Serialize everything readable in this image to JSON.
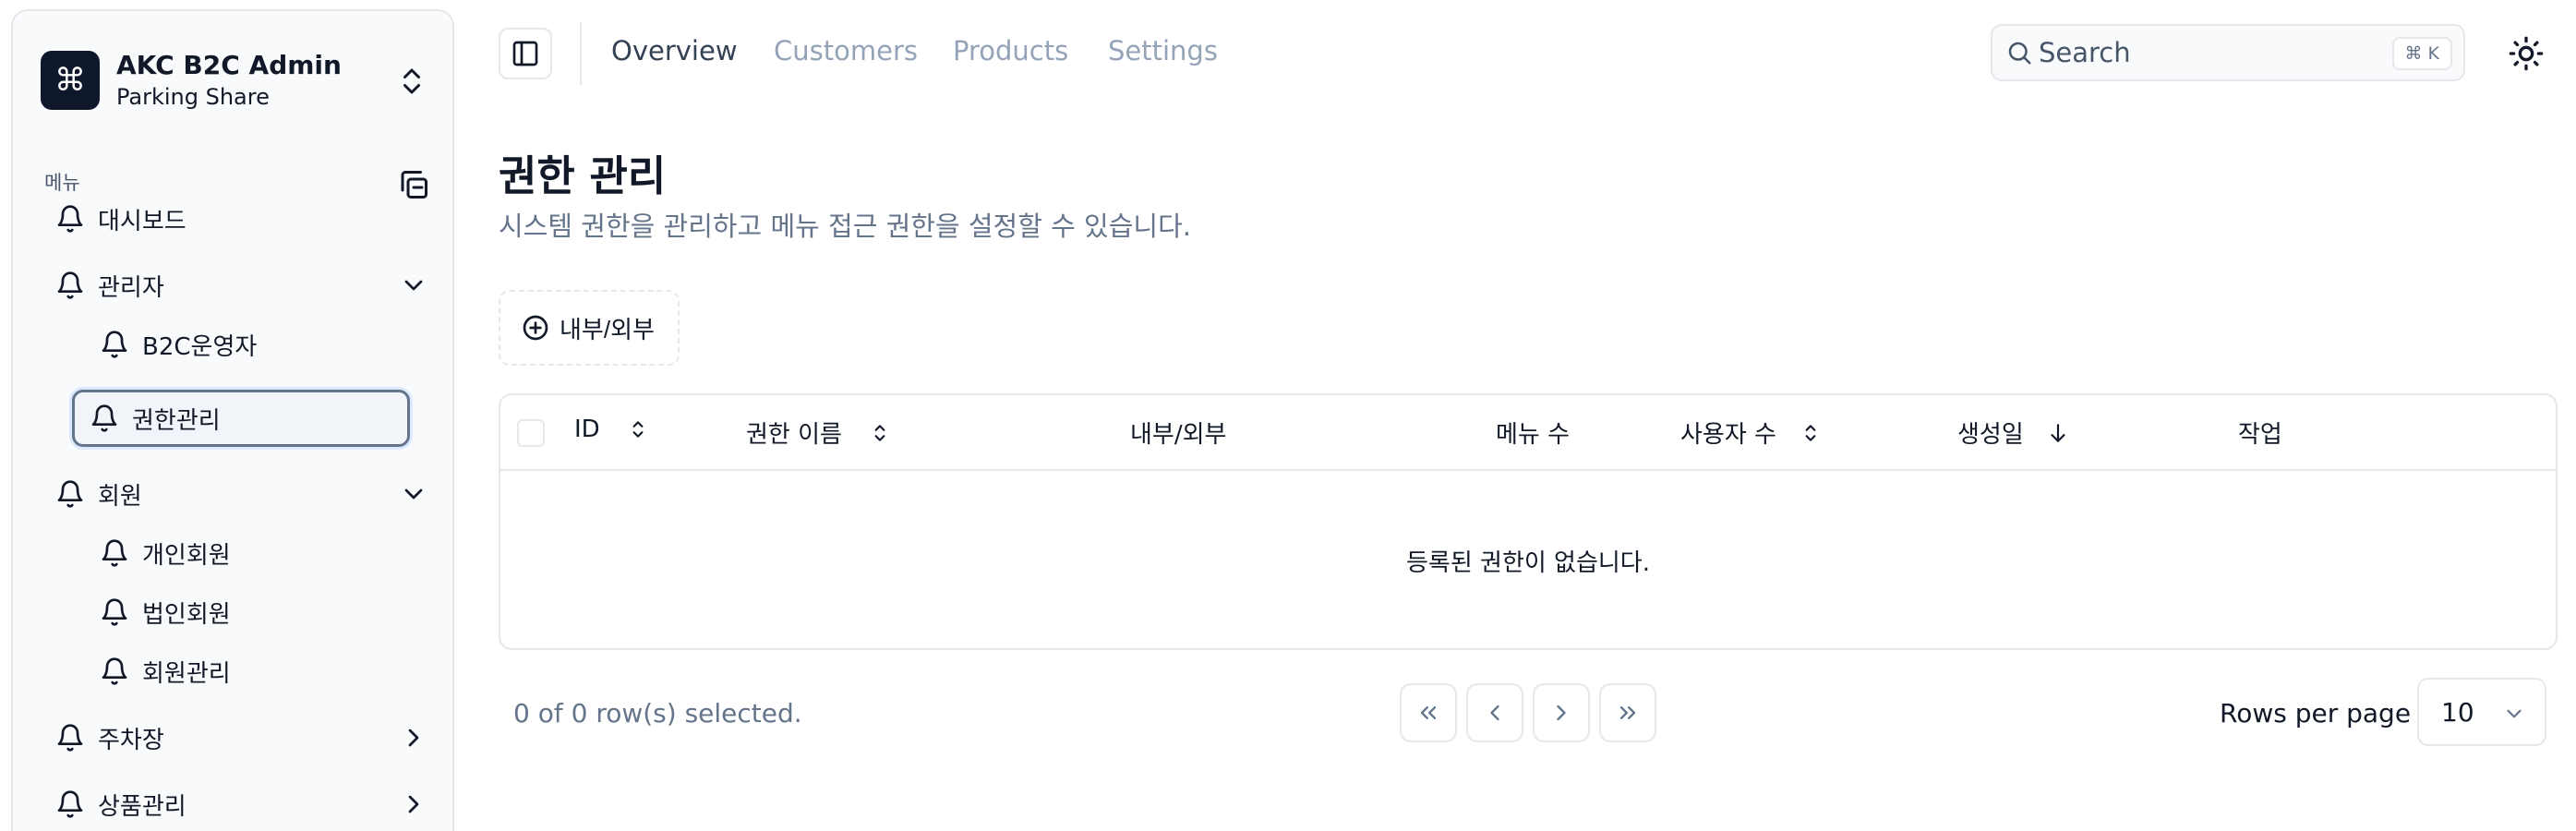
{
  "brand": {
    "logo_glyph": "⌘",
    "name": "AKC B2C Admin",
    "subtitle": "Parking Share"
  },
  "sidebar": {
    "menu_heading": "메뉴",
    "items": [
      {
        "label": "대시보드"
      },
      {
        "label": "관리자",
        "expanded": true
      },
      {
        "label": "B2C운영자"
      },
      {
        "label": "권한관리",
        "active": true
      },
      {
        "label": "회원",
        "expanded": true
      },
      {
        "label": "개인회원"
      },
      {
        "label": "법인회원"
      },
      {
        "label": "회원관리"
      },
      {
        "label": "주차장",
        "expanded": false
      },
      {
        "label": "상품관리",
        "expanded": false
      }
    ]
  },
  "topbar": {
    "tabs": [
      {
        "label": "Overview",
        "active": true
      },
      {
        "label": "Customers"
      },
      {
        "label": "Products"
      },
      {
        "label": "Settings"
      }
    ],
    "search": {
      "placeholder": "Search",
      "value": "",
      "shortcut": "⌘ K"
    }
  },
  "page": {
    "title": "권한 관리",
    "description": "시스템 권한을 관리하고 메뉴 접근 권한을 설정할 수 있습니다."
  },
  "filter": {
    "label": "내부/외부"
  },
  "table": {
    "columns": [
      "ID",
      "권한 이름",
      "내부/외부",
      "메뉴 수",
      "사용자 수",
      "생성일",
      "작업"
    ],
    "rows": [],
    "empty_message": "등록된 권한이 없습니다."
  },
  "pagination": {
    "selected_text": "0 of 0 row(s) selected.",
    "rows_per_page_label": "Rows per page",
    "rows_per_page": "10"
  },
  "colors": {
    "brand_logo_bg": "#0f172a",
    "sidebar_bg": "#f8fafc",
    "border": "#e5e7eb",
    "muted_text": "#64748b",
    "inactive_tab": "#94a3b8"
  }
}
